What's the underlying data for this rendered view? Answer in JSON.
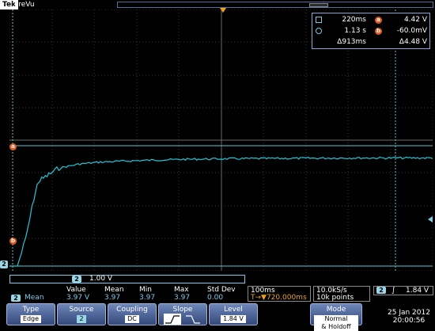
{
  "header": {
    "brand": "Tek",
    "status": "PreVu"
  },
  "cursor_readout": {
    "row1": {
      "value": "220ms",
      "marker": "a",
      "voltage": "4.42 V"
    },
    "row2": {
      "value": "1.13 s",
      "marker": "b",
      "voltage": "-60.0mV"
    },
    "row3": {
      "value": "Δ913ms",
      "voltage": "Δ4.48 V"
    }
  },
  "markers": {
    "a": "a",
    "b": "b",
    "ch2_ground": "2"
  },
  "channel": {
    "badge": "2",
    "scale": "1.00 V"
  },
  "measurement": {
    "channel": "2",
    "label": "Mean",
    "headers": [
      "Value",
      "Mean",
      "Min",
      "Max",
      "Std Dev"
    ],
    "values": [
      "3.97 V",
      "3.97",
      "3.97",
      "3.97",
      "0.00"
    ]
  },
  "timebase": {
    "scale": "100ms",
    "position": "T→▼720.000ms"
  },
  "acquisition": {
    "rate": "10.0kS/s",
    "points": "10k points"
  },
  "trigger": {
    "channel": "2",
    "slope_symbol": "∫",
    "level": "1.84 V"
  },
  "menu": {
    "type": {
      "label": "Type",
      "value": "Edge"
    },
    "source": {
      "label": "Source",
      "value": "2"
    },
    "coupling": {
      "label": "Coupling",
      "value": "DC"
    },
    "slope": {
      "label": "Slope"
    },
    "level": {
      "label": "Level",
      "value": "1.84 V"
    },
    "mode": {
      "label": "Mode",
      "line1": "Normal",
      "line2": "& Holdoff"
    }
  },
  "datetime": {
    "date": "25 Jan 2012",
    "time": "20:00:56"
  },
  "colors": {
    "trace": "#27c6d6",
    "cursor": "#5fc4d6",
    "grid": "#3a3a3a",
    "accent": "#e2581f"
  },
  "chart_data": {
    "type": "line",
    "x": [
      0,
      0.02,
      0.04,
      0.05,
      0.08,
      0.1,
      0.15,
      0.2,
      0.3,
      0.4,
      0.5,
      0.6,
      0.7,
      0.8,
      0.9,
      1.0
    ],
    "series": [
      {
        "values": [
          0,
          1.0,
          2.5,
          3.1,
          3.4,
          3.6,
          3.75,
          3.82,
          3.88,
          3.92,
          3.94,
          3.95,
          3.96,
          3.97,
          3.97,
          3.97
        ]
      }
    ]
  }
}
